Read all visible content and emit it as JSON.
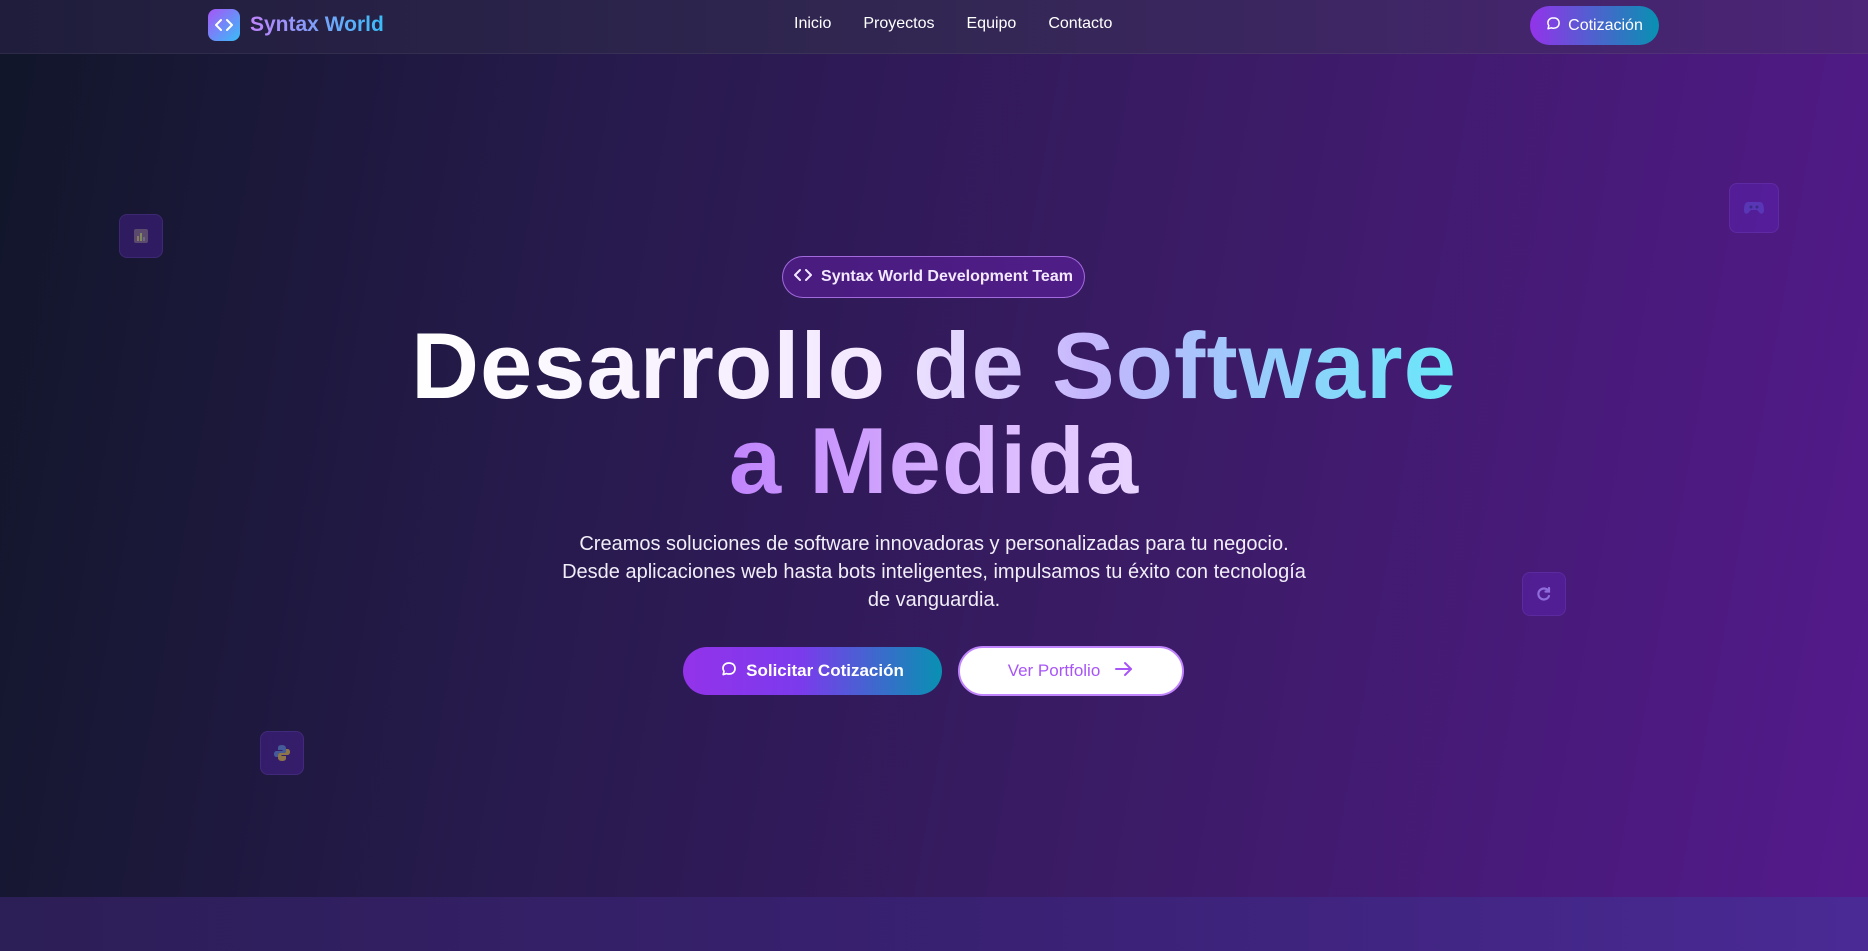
{
  "nav": {
    "brand": "Syntax World",
    "links": [
      {
        "label": "Inicio"
      },
      {
        "label": "Proyectos"
      },
      {
        "label": "Equipo"
      },
      {
        "label": "Contacto"
      }
    ],
    "cta_label": "Cotización"
  },
  "hero": {
    "badge": "Syntax World Development Team",
    "title_line1": "Desarrollo de Software",
    "title_line2": "a Medida",
    "subtitle_line1": "Creamos soluciones de software innovadoras y personalizadas para tu negocio.",
    "subtitle_line2": "Desde aplicaciones web hasta bots inteligentes, impulsamos tu éxito con tecnología",
    "subtitle_line3": "de vanguardia.",
    "primary_button": "Solicitar Cotización",
    "secondary_button": "Ver Portfolio"
  },
  "colors": {
    "accent_purple": "#9333ea",
    "accent_cyan": "#0891b2",
    "badge_border": "#c084fc"
  },
  "icons": {
    "logo": "code-icon",
    "chat": "chat-bubble-icon",
    "arrow": "arrow-right-icon",
    "floating": [
      "chart-icon",
      "gamepad-icon",
      "refresh-icon",
      "python-icon"
    ]
  }
}
